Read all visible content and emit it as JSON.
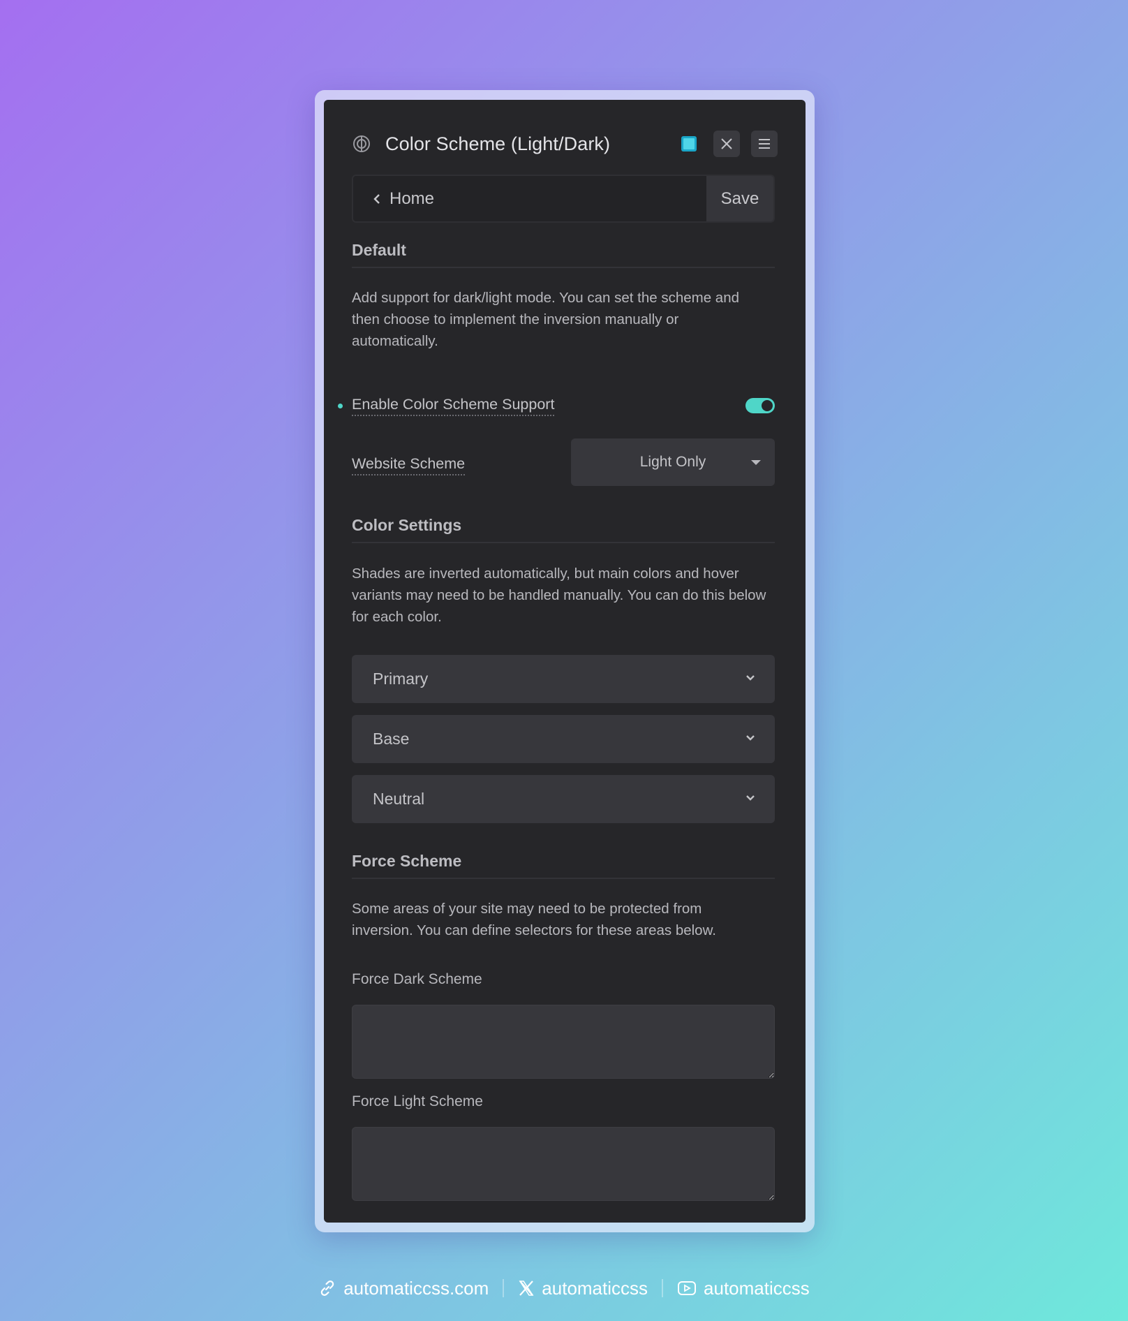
{
  "panel": {
    "title": "Color Scheme (Light/Dark)",
    "icons": {
      "logo": "color-scheme-icon",
      "swatch": "square-icon",
      "close": "close-icon",
      "menu": "menu-icon"
    },
    "accent_color": "#4fd6c8"
  },
  "nav": {
    "back_label": "Home",
    "save_label": "Save"
  },
  "default_section": {
    "title": "Default",
    "description": "Add support for dark/light mode. You can set the scheme and then choose to implement the inversion manually or automatically.",
    "toggle_label": "Enable Color Scheme Support",
    "toggle_on": true,
    "scheme_label": "Website Scheme",
    "scheme_value": "Light Only"
  },
  "color_settings": {
    "title": "Color Settings",
    "description": "Shades are inverted automatically, but main colors and hover variants may need to be handled manually. You can do this below for each color.",
    "items": [
      {
        "label": "Primary"
      },
      {
        "label": "Base"
      },
      {
        "label": "Neutral"
      }
    ]
  },
  "force_scheme": {
    "title": "Force Scheme",
    "description": "Some areas of your site may need to be protected from inversion. You can define selectors for these areas below.",
    "dark_label": "Force Dark Scheme",
    "dark_value": "",
    "light_label": "Force Light Scheme",
    "light_value": ""
  },
  "footer": {
    "website": "automaticcss.com",
    "x_handle": "automaticcss",
    "youtube_handle": "automaticcss"
  }
}
